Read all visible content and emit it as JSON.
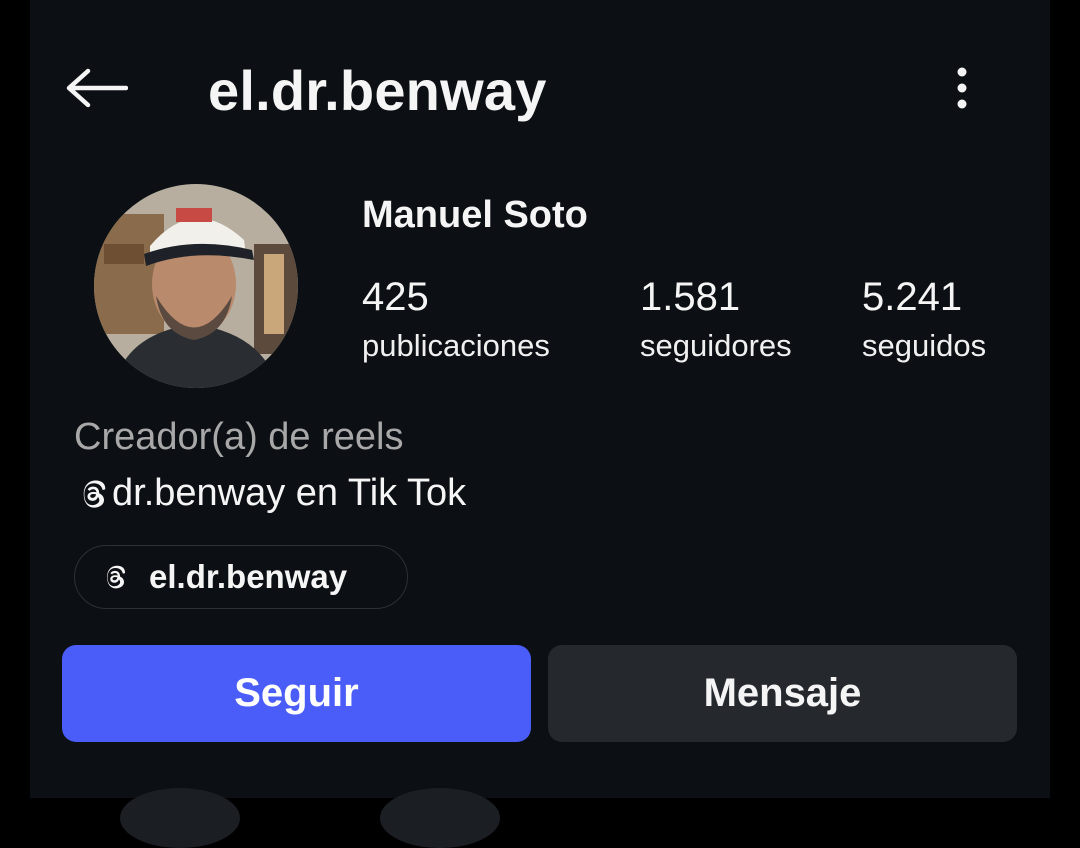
{
  "header": {
    "back_icon": "arrow-left-icon",
    "username": "el.dr.benway",
    "more_icon": "vertical-dots-icon"
  },
  "profile": {
    "avatar": "profile-photo",
    "full_name": "Manuel Soto",
    "stats": [
      {
        "value": "425",
        "label": "publicaciones"
      },
      {
        "value": "1.581",
        "label": "seguidores"
      },
      {
        "value": "5.241",
        "label": "seguidos"
      }
    ],
    "category": "Creador(a) de reels",
    "bio_icon": "threads-icon",
    "bio_text": "dr.benway en Tik Tok",
    "threads_link": {
      "icon": "threads-icon",
      "label": "el.dr.benway"
    }
  },
  "actions": {
    "follow_label": "Seguir",
    "message_label": "Mensaje"
  },
  "colors": {
    "background": "#0c1014",
    "primary_button": "#4a5df9",
    "secondary_button": "#25292e",
    "muted_text": "#a8a8a8"
  }
}
